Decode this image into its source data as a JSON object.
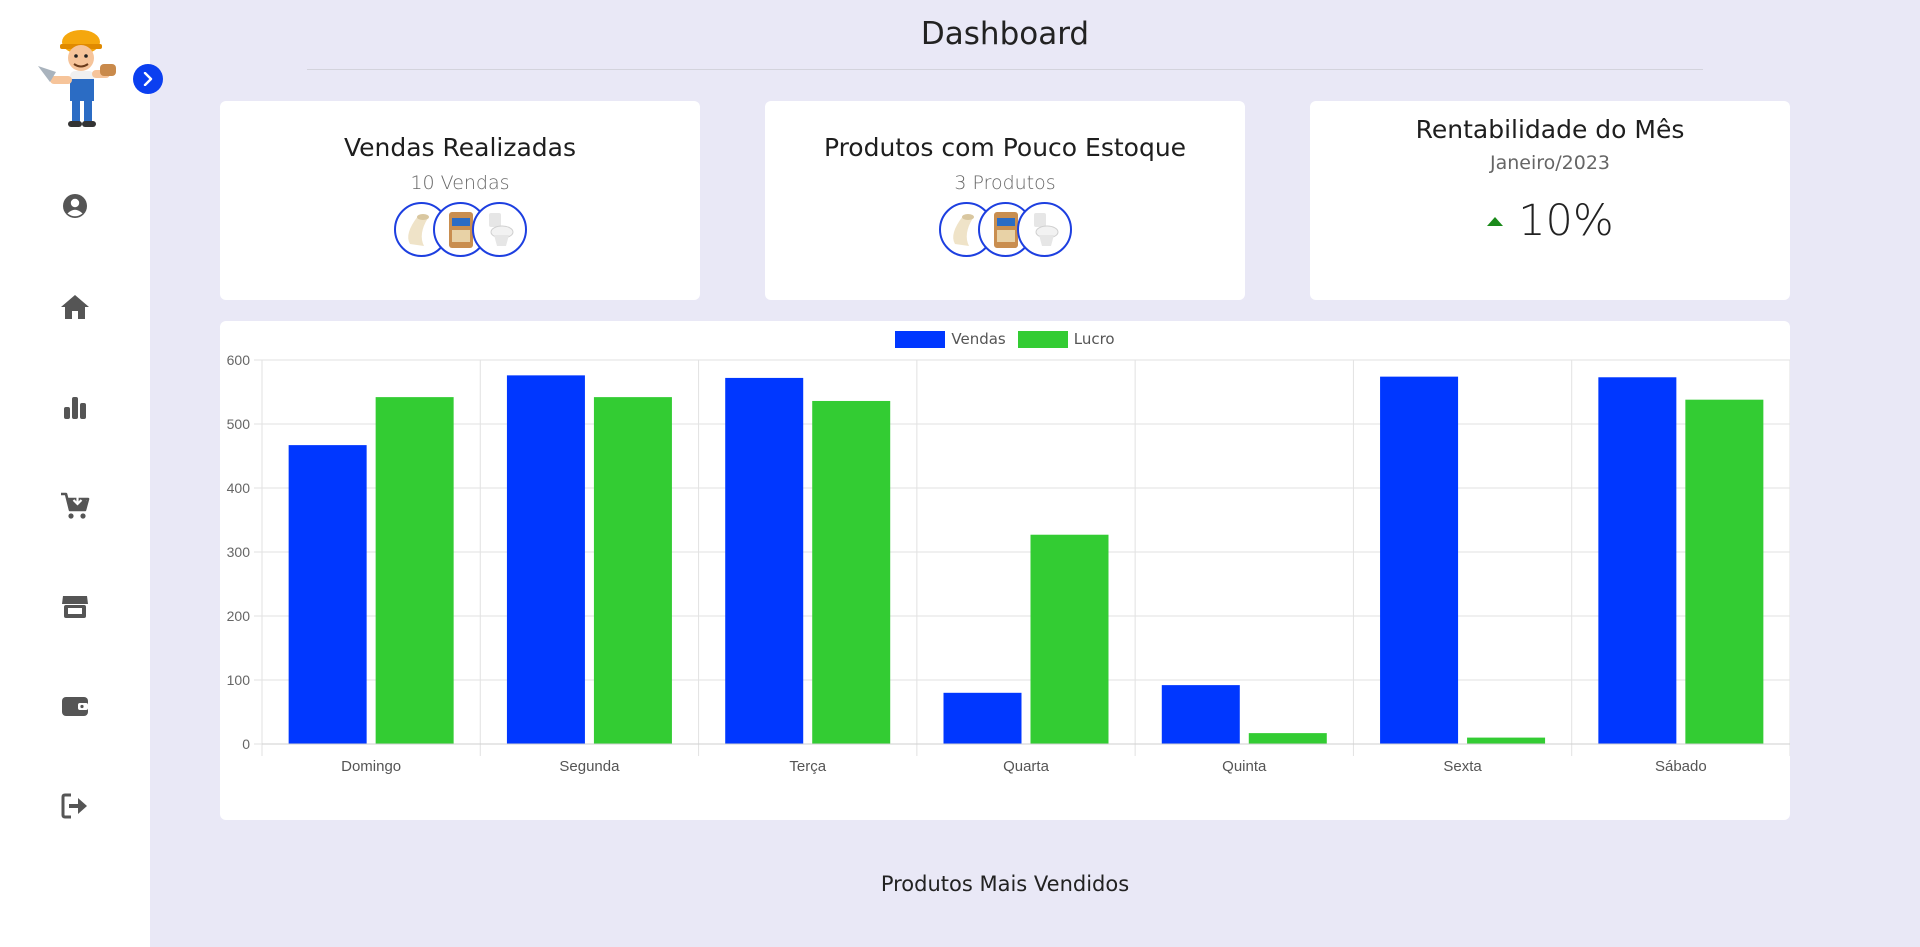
{
  "header": {
    "title": "Dashboard"
  },
  "sidebar": {
    "items": [
      {
        "name": "profile",
        "icon": "user-circle-icon"
      },
      {
        "name": "home",
        "icon": "home-icon"
      },
      {
        "name": "reports",
        "icon": "bar-chart-icon"
      },
      {
        "name": "purchases",
        "icon": "cart-download-icon"
      },
      {
        "name": "store",
        "icon": "store-icon"
      },
      {
        "name": "wallet",
        "icon": "wallet-icon"
      },
      {
        "name": "logout",
        "icon": "sign-out-icon"
      }
    ]
  },
  "cards": {
    "sales": {
      "title": "Vendas Realizadas",
      "subtitle": "10 Vendas"
    },
    "low_stock": {
      "title": "Produtos com Pouco Estoque",
      "subtitle": "3 Produtos"
    },
    "profit": {
      "title": "Rentabilidade do Mês",
      "period": "Janeiro/2023",
      "value": "10%",
      "trend": "up"
    }
  },
  "colors": {
    "accent": "#0b3ff0",
    "vendas": "#0037ff",
    "lucro": "#33cc33",
    "trend_up": "#1a8a1a"
  },
  "chart_data": {
    "type": "bar",
    "categories": [
      "Domingo",
      "Segunda",
      "Terça",
      "Quarta",
      "Quinta",
      "Sexta",
      "Sábado"
    ],
    "series": [
      {
        "name": "Vendas",
        "values": [
          467,
          576,
          572,
          80,
          92,
          574,
          573
        ]
      },
      {
        "name": "Lucro",
        "values": [
          542,
          542,
          536,
          327,
          17,
          10,
          538
        ]
      }
    ],
    "yticks": [
      0,
      100,
      200,
      300,
      400,
      500,
      600
    ],
    "ylim": [
      0,
      600
    ],
    "legend": "top-center",
    "grid": true
  },
  "section": {
    "title": "Produtos Mais Vendidos"
  }
}
